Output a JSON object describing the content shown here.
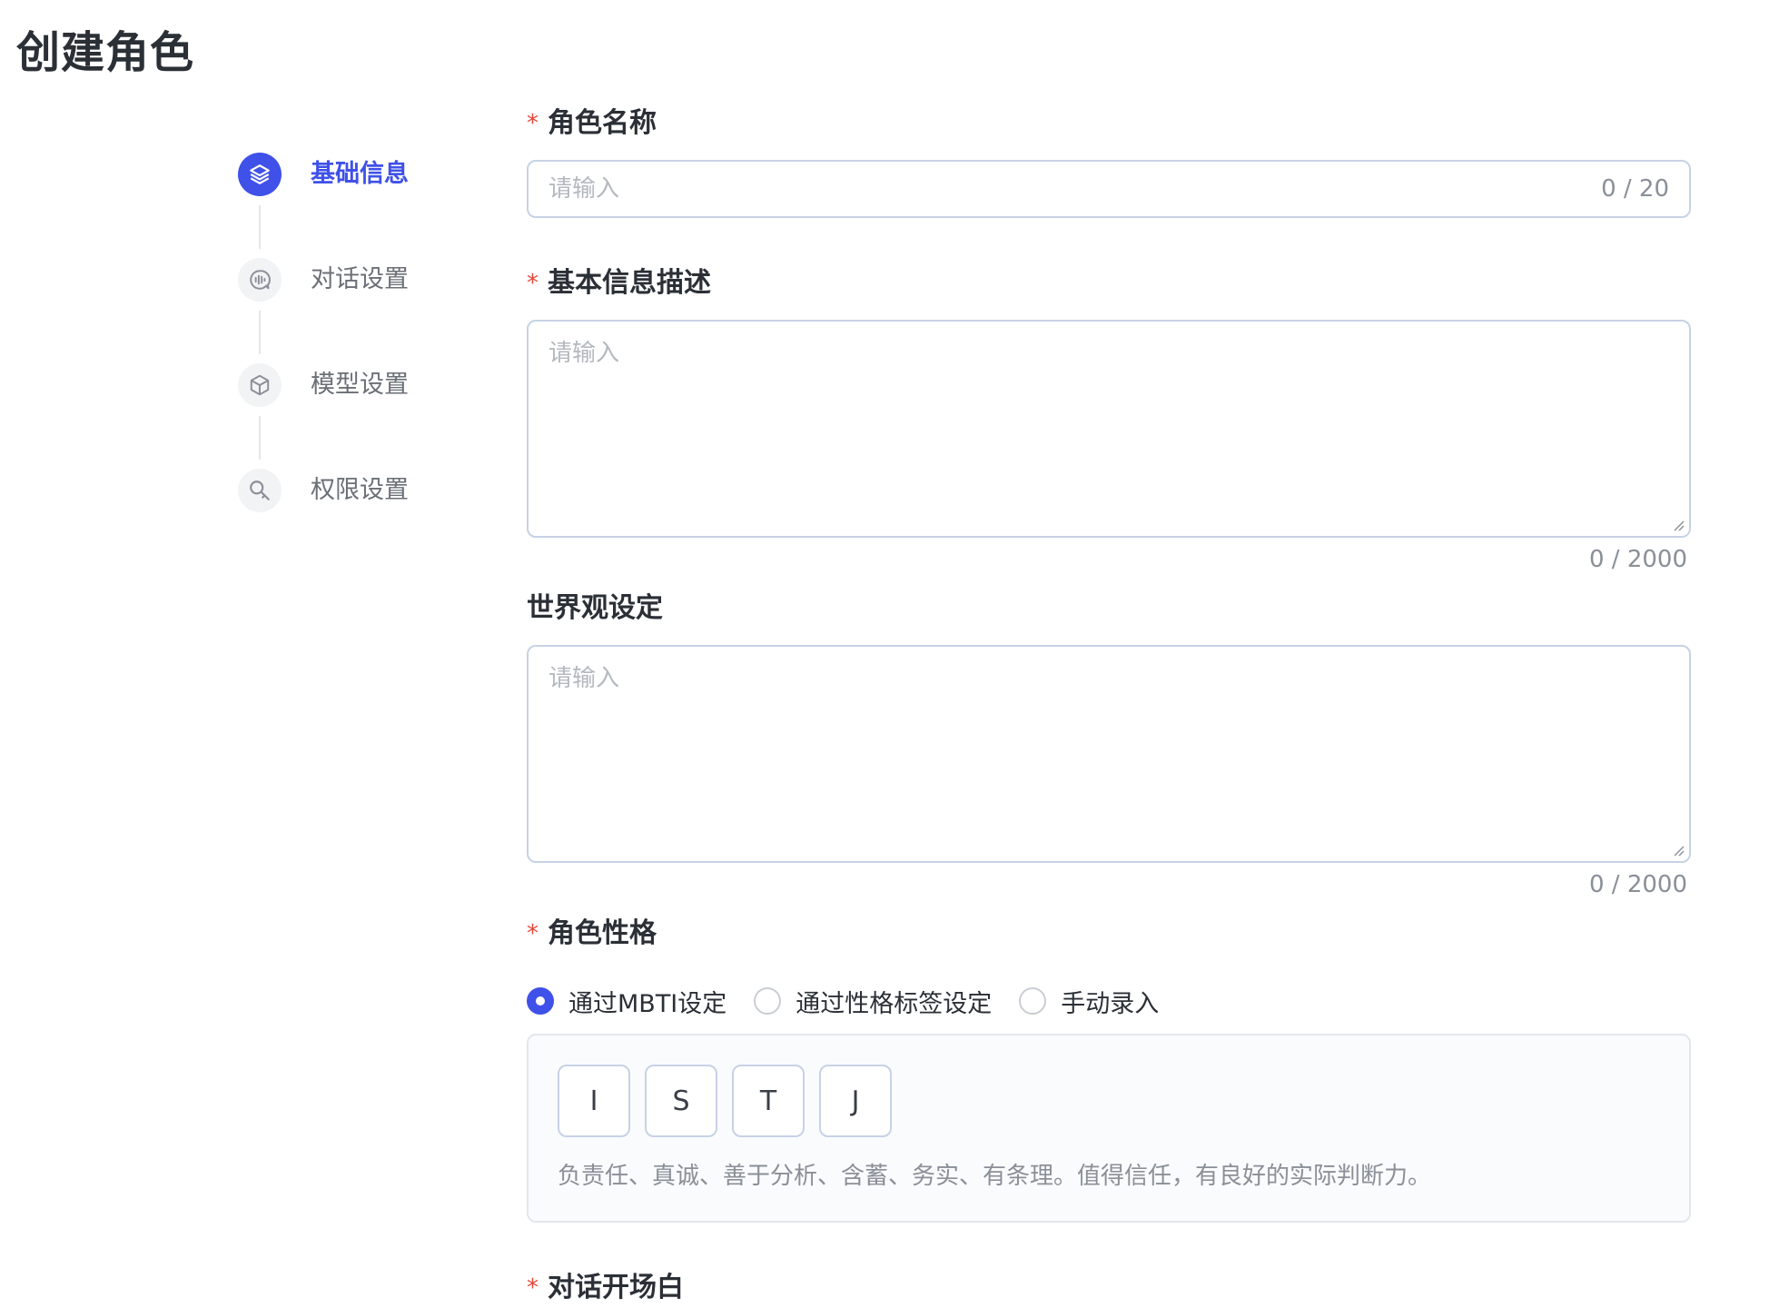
{
  "page": {
    "title": "创建角色"
  },
  "steps": [
    {
      "label": "基础信息",
      "icon": "layers-icon",
      "active": true
    },
    {
      "label": "对话设置",
      "icon": "chat-wave-icon",
      "active": false
    },
    {
      "label": "模型设置",
      "icon": "cube-icon",
      "active": false
    },
    {
      "label": "权限设置",
      "icon": "key-icon",
      "active": false
    }
  ],
  "form": {
    "role_name": {
      "label": "角色名称",
      "required_mark": "*",
      "placeholder": "请输入",
      "counter": "0 / 20"
    },
    "basic_desc": {
      "label": "基本信息描述",
      "required_mark": "*",
      "placeholder": "请输入",
      "counter": "0 / 2000"
    },
    "worldview": {
      "label": "世界观设定",
      "placeholder": "请输入",
      "counter": "0 / 2000"
    },
    "personality": {
      "label": "角色性格",
      "required_mark": "*",
      "options": [
        {
          "label": "通过MBTI设定",
          "checked": true
        },
        {
          "label": "通过性格标签设定",
          "checked": false
        },
        {
          "label": "手动录入",
          "checked": false
        }
      ],
      "mbti": {
        "letters": [
          "I",
          "S",
          "T",
          "J"
        ],
        "description": "负责任、真诚、善于分析、含蓄、务实、有条理。值得信任，有良好的实际判断力。"
      }
    },
    "opening": {
      "label": "对话开场白",
      "required_mark": "*"
    }
  },
  "colors": {
    "primary": "#3f51e8",
    "required": "#e5483a",
    "border": "#c7d2e6"
  }
}
